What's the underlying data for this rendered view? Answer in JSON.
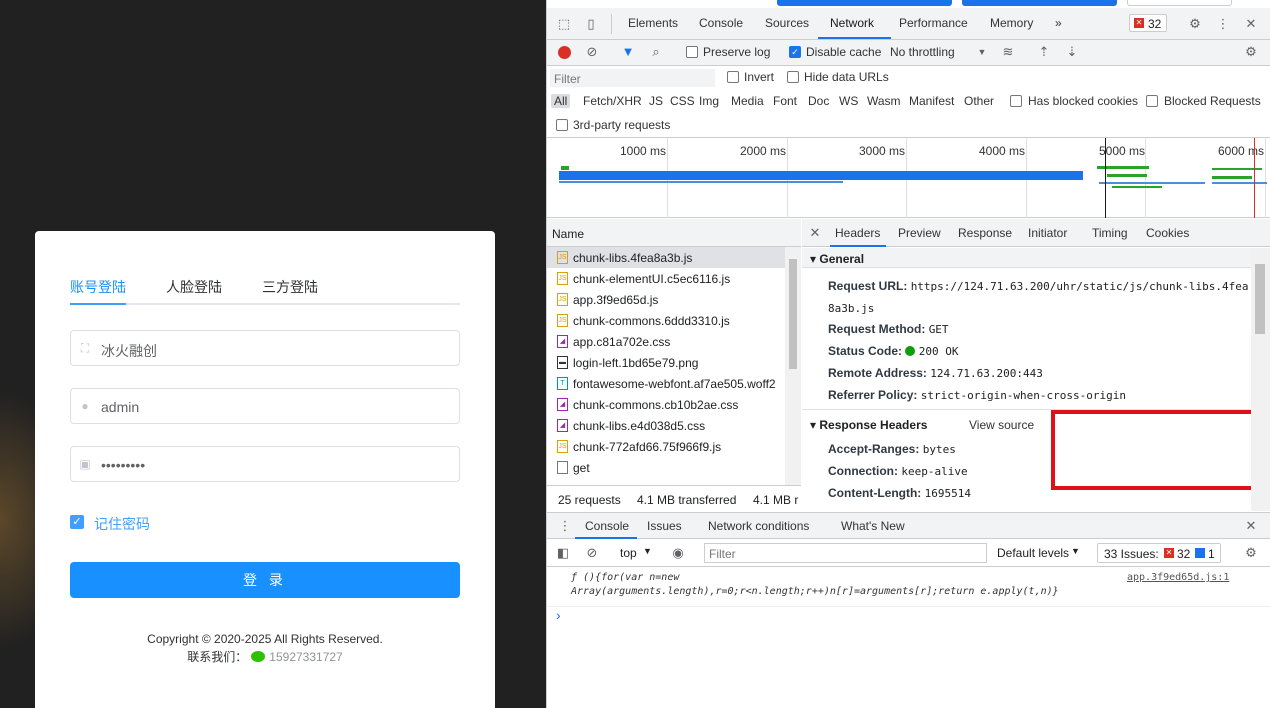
{
  "login": {
    "tabs": [
      "账号登陆",
      "人脸登陆",
      "三方登陆"
    ],
    "org_value": "冰火融创",
    "username_value": "admin",
    "password_value": "•••••••••",
    "remember_label": "记住密码",
    "login_button": "登 录",
    "copyright": "Copyright © 2020-2025 All Rights Reserved.",
    "contact_label": "联系我们：",
    "contact_phone": "15927331727"
  },
  "devtools": {
    "main_tabs": [
      "Elements",
      "Console",
      "Sources",
      "Network",
      "Performance",
      "Memory"
    ],
    "active_tab": "Network",
    "more_tabs": "»",
    "error_count": "32",
    "toolbar": {
      "preserve_log": "Preserve log",
      "disable_cache": "Disable cache",
      "throttling": "No throttling"
    },
    "filter": {
      "placeholder": "Filter",
      "invert": "Invert",
      "hide_data_urls": "Hide data URLs",
      "types": [
        "All",
        "Fetch/XHR",
        "JS",
        "CSS",
        "Img",
        "Media",
        "Font",
        "Doc",
        "WS",
        "Wasm",
        "Manifest",
        "Other"
      ],
      "has_blocked_cookies": "Has blocked cookies",
      "blocked_requests": "Blocked Requests",
      "third_party": "3rd-party requests"
    },
    "timeline_labels": [
      "1000 ms",
      "2000 ms",
      "3000 ms",
      "4000 ms",
      "5000 ms",
      "6000 ms"
    ],
    "requests_header": "Name",
    "requests": [
      {
        "name": "chunk-libs.4fea8a3b.js",
        "type": "js"
      },
      {
        "name": "chunk-elementUI.c5ec6116.js",
        "type": "js"
      },
      {
        "name": "app.3f9ed65d.js",
        "type": "js"
      },
      {
        "name": "chunk-commons.6ddd3310.js",
        "type": "js"
      },
      {
        "name": "app.c81a702e.css",
        "type": "css"
      },
      {
        "name": "login-left.1bd65e79.png",
        "type": "img"
      },
      {
        "name": "fontawesome-webfont.af7ae505.woff2",
        "type": "font"
      },
      {
        "name": "chunk-commons.cb10b2ae.css",
        "type": "css"
      },
      {
        "name": "chunk-libs.e4d038d5.css",
        "type": "css"
      },
      {
        "name": "chunk-772afd66.75f966f9.js",
        "type": "js"
      },
      {
        "name": "get",
        "type": "doc"
      }
    ],
    "footer": {
      "requests": "25 requests",
      "transferred": "4.1 MB transferred",
      "resources": "4.1 MB r"
    },
    "detail_tabs": [
      "Headers",
      "Preview",
      "Response",
      "Initiator",
      "Timing",
      "Cookies"
    ],
    "general": {
      "title": "General",
      "request_url_key": "Request URL:",
      "request_url_line1": "https://124.71.63.200/uhr/static/js/chunk-libs.4fea",
      "request_url_line2": "8a3b.js",
      "method_key": "Request Method:",
      "method": "GET",
      "status_key": "Status Code:",
      "status": "200 OK",
      "remote_key": "Remote Address:",
      "remote": "124.71.63.200:443",
      "referrer_key": "Referrer Policy:",
      "referrer": "strict-origin-when-cross-origin"
    },
    "response_headers": {
      "title": "Response Headers",
      "view_source": "View source",
      "accept_ranges_key": "Accept-Ranges:",
      "accept_ranges": "bytes",
      "connection_key": "Connection:",
      "connection": "keep-alive",
      "content_length_key": "Content-Length:",
      "content_length": "1695514"
    },
    "drawer": {
      "tabs": [
        "Console",
        "Issues",
        "Network conditions",
        "What's New"
      ],
      "context": "top",
      "filter_placeholder": "Filter",
      "levels": "Default levels",
      "issues_label": "33 Issues:",
      "issues_errors": "32",
      "issues_info": "1",
      "log_line1": "ƒ (){for(var n=new",
      "log_line2": "Array(arguments.length),r=0;r<n.length;r++)n[r]=arguments[r];return e.apply(t,n)}",
      "log_source": "app.3f9ed65d.js:1",
      "prompt": "›"
    }
  }
}
